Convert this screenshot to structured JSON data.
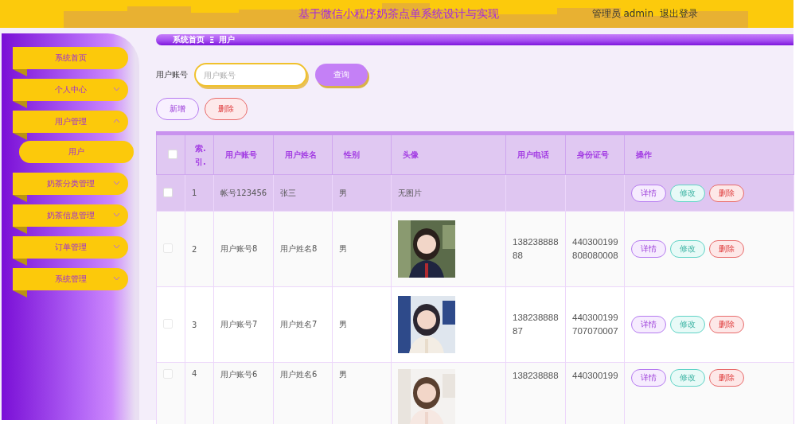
{
  "header": {
    "title": "基于微信小程序奶茶点单系统设计与实现",
    "role": "管理员",
    "username": "admin",
    "logout": "退出登录"
  },
  "sidebar": {
    "items": [
      {
        "label": "系统首页",
        "kind": "link"
      },
      {
        "label": "个人中心",
        "kind": "menu",
        "expanded": false
      },
      {
        "label": "用户管理",
        "kind": "menu",
        "expanded": true,
        "children": [
          {
            "label": "用户",
            "selected": true
          }
        ]
      },
      {
        "label": "奶茶分类管理",
        "kind": "menu",
        "expanded": false
      },
      {
        "label": "奶茶信息管理",
        "kind": "menu",
        "expanded": false
      },
      {
        "label": "订单管理",
        "kind": "menu",
        "expanded": false
      },
      {
        "label": "系统管理",
        "kind": "menu",
        "expanded": false
      }
    ]
  },
  "breadcrumb": {
    "home": "系统首页",
    "separator": "Ξ",
    "current": "用户"
  },
  "search": {
    "label": "用户账号",
    "placeholder": "用户账号",
    "button": "查询"
  },
  "actions": [
    "新增",
    "删除"
  ],
  "table": {
    "select_all_checked": false,
    "columns": [
      "索.引.",
      "用户账号",
      "用户姓名",
      "性别",
      "头像",
      "用户电话",
      "身份证号",
      "操作"
    ],
    "rows": [
      {
        "selected": true,
        "checked": false,
        "index": "1",
        "account": "帐号123456",
        "name": "张三",
        "gender": "男",
        "avatar": {
          "kind": "text",
          "text": "无图片"
        },
        "phone": "",
        "id_number": "",
        "actions": [
          "详情",
          "修改",
          "删除"
        ]
      },
      {
        "selected": false,
        "checked": false,
        "index": "2",
        "account": "用户账号8",
        "name": "用户姓名8",
        "gender": "男",
        "avatar": {
          "kind": "picture"
        },
        "phone": "13823888888",
        "id_number": "440300199808080008",
        "actions": [
          "详情",
          "修改",
          "删除"
        ]
      },
      {
        "selected": false,
        "checked": false,
        "index": "3",
        "account": "用户账号7",
        "name": "用户姓名7",
        "gender": "男",
        "avatar": {
          "kind": "picture"
        },
        "phone": "13823888887",
        "id_number": "440300199707070007",
        "actions": [
          "详情",
          "修改",
          "删除"
        ]
      },
      {
        "selected": false,
        "checked": false,
        "index": "4",
        "account": "用户账号6",
        "name": "用户姓名6",
        "gender": "男",
        "avatar": {
          "kind": "picture"
        },
        "phone": "138238888",
        "id_number": "440300199",
        "actions": [
          "详情",
          "修改",
          "删除"
        ]
      }
    ]
  }
}
